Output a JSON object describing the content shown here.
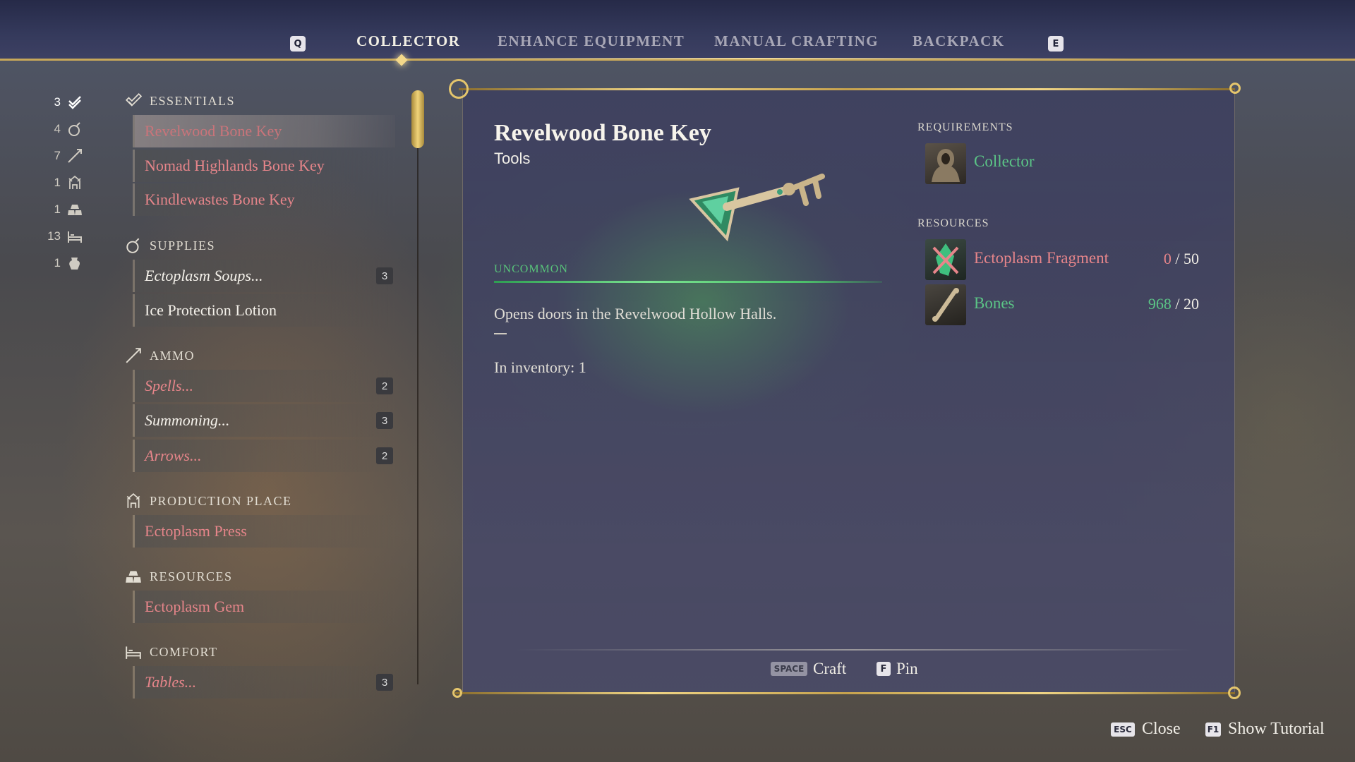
{
  "tabs": {
    "prev_key": "Q",
    "next_key": "E",
    "items": [
      "COLLECTOR",
      "ENHANCE EQUIPMENT",
      "MANUAL CRAFTING",
      "BACKPACK"
    ],
    "active": "COLLECTOR"
  },
  "counters": [
    {
      "count": "3",
      "icon": "essentials-icon"
    },
    {
      "count": "4",
      "icon": "potion-icon"
    },
    {
      "count": "7",
      "icon": "arrow-icon"
    },
    {
      "count": "1",
      "icon": "production-icon"
    },
    {
      "count": "1",
      "icon": "resources-icon"
    },
    {
      "count": "13",
      "icon": "bed-icon"
    },
    {
      "count": "1",
      "icon": "jug-icon"
    }
  ],
  "categories": {
    "essentials": {
      "title": "ESSENTIALS",
      "items": [
        {
          "label": "Revelwood Bone Key"
        },
        {
          "label": "Nomad Highlands Bone Key"
        },
        {
          "label": "Kindlewastes Bone Key"
        }
      ]
    },
    "supplies": {
      "title": "SUPPLIES",
      "items": [
        {
          "label": "Ectoplasm Soups...",
          "badge": "3"
        },
        {
          "label": "Ice Protection Lotion"
        }
      ]
    },
    "ammo": {
      "title": "AMMO",
      "items": [
        {
          "label": "Spells...",
          "badge": "2"
        },
        {
          "label": "Summoning...",
          "badge": "3"
        },
        {
          "label": "Arrows...",
          "badge": "2"
        }
      ]
    },
    "production": {
      "title": "PRODUCTION PLACE",
      "items": [
        {
          "label": "Ectoplasm Press"
        }
      ]
    },
    "resources": {
      "title": "RESOURCES",
      "items": [
        {
          "label": "Ectoplasm Gem"
        }
      ]
    },
    "comfort": {
      "title": "COMFORT",
      "items": [
        {
          "label": "Tables...",
          "badge": "3"
        }
      ]
    }
  },
  "detail": {
    "title": "Revelwood Bone Key",
    "subtitle": "Tools",
    "rarity": "UNCOMMON",
    "description": "Opens doors in the Revelwood Hollow Halls.",
    "inventory": "In inventory: 1",
    "requirements_label": "REQUIREMENTS",
    "requirement": "Collector",
    "resources_label": "RESOURCES",
    "resources": [
      {
        "name": "Ectoplasm Fragment",
        "have": "0",
        "need": "/ 50"
      },
      {
        "name": "Bones",
        "have": "968",
        "need": "/ 20"
      }
    ]
  },
  "actions": {
    "craft_key": "SPACE",
    "craft_label": "Craft",
    "pin_key": "F",
    "pin_label": "Pin"
  },
  "footer": {
    "close_key": "ESC",
    "close_label": "Close",
    "tutorial_key": "F1",
    "tutorial_label": "Show Tutorial"
  },
  "colors": {
    "accent_gold": "#e4c56c",
    "uncraftable_red": "#e6858a",
    "available_green": "#5bc486"
  }
}
